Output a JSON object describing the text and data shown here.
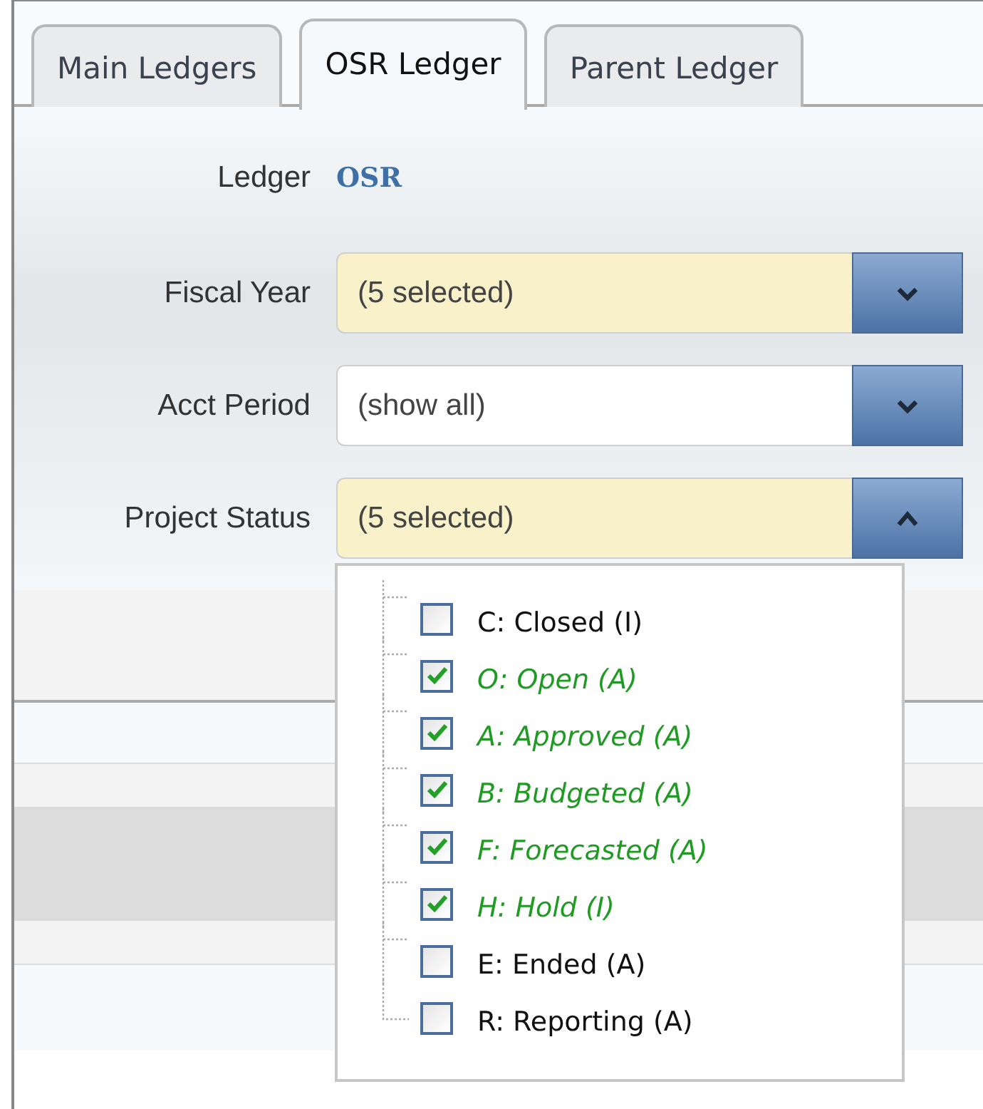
{
  "tabs": [
    {
      "label": "Main Ledgers",
      "selected": false
    },
    {
      "label": "OSR Ledger",
      "selected": true
    },
    {
      "label": "Parent Ledger",
      "selected": false
    }
  ],
  "ledger": {
    "label": "Ledger",
    "value": "OSR"
  },
  "filters": [
    {
      "label": "Fiscal Year",
      "value": "(5 selected)",
      "highlighted": true,
      "expanded": false
    },
    {
      "label": "Acct Period",
      "value": "(show all)",
      "highlighted": false,
      "expanded": false
    },
    {
      "label": "Project Status",
      "value": "(5 selected)",
      "highlighted": true,
      "expanded": true
    }
  ],
  "status_options": [
    {
      "label": "C: Closed (I)",
      "checked": false
    },
    {
      "label": "O: Open (A)",
      "checked": true
    },
    {
      "label": "A: Approved (A)",
      "checked": true
    },
    {
      "label": "B: Budgeted (A)",
      "checked": true
    },
    {
      "label": "F: Forecasted (A)",
      "checked": true
    },
    {
      "label": "H: Hold (I)",
      "checked": true
    },
    {
      "label": "E: Ended (A)",
      "checked": false
    },
    {
      "label": "R: Reporting (A)",
      "checked": false
    }
  ]
}
